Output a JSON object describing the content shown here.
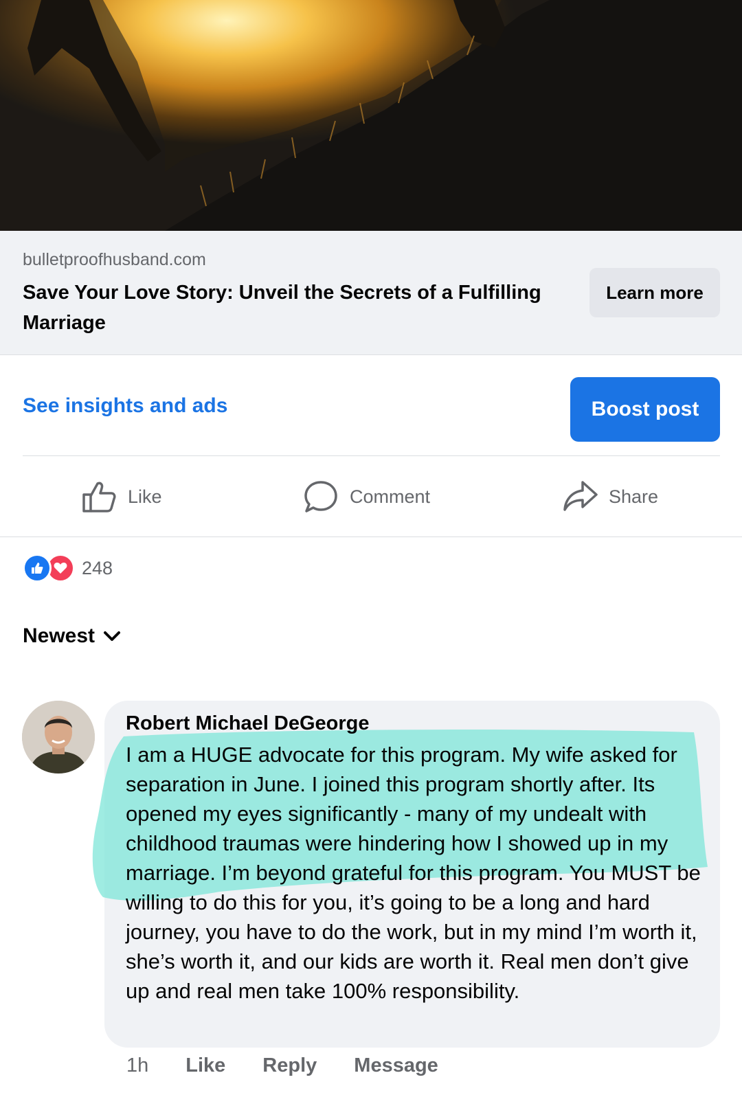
{
  "link_preview": {
    "domain": "bulletproofhusband.com",
    "headline": "Save Your Love Story: Unveil the Secrets of a Fulfilling Marriage",
    "cta_label": "Learn more"
  },
  "post_tools": {
    "insights_label": "See insights and ads",
    "boost_label": "Boost post"
  },
  "actions": {
    "like_label": "Like",
    "comment_label": "Comment",
    "share_label": "Share"
  },
  "reactions": {
    "count": "248"
  },
  "comments_sort": {
    "label": "Newest"
  },
  "comment": {
    "author": "Robert Michael DeGeorge",
    "text": "I am a HUGE advocate for this program. My wife asked for separation in June. I joined this program shortly after. Its opened my eyes significantly - many of my undealt with childhood traumas were hindering how I showed up in my marriage. I’m beyond grateful for this program. You MUST be willing to do this for you, it’s going to be a long and hard journey, you have to do the work, but in my mind I’m worth it, she’s worth it, and our kids are worth it. Real men don’t give up and real men take 100% responsibility.",
    "time": "1h",
    "like_label": "Like",
    "reply_label": "Reply",
    "message_label": "Message"
  },
  "colors": {
    "accent": "#1b74e4",
    "highlight": "#7fe6d8",
    "bubble": "#f0f2f5"
  }
}
